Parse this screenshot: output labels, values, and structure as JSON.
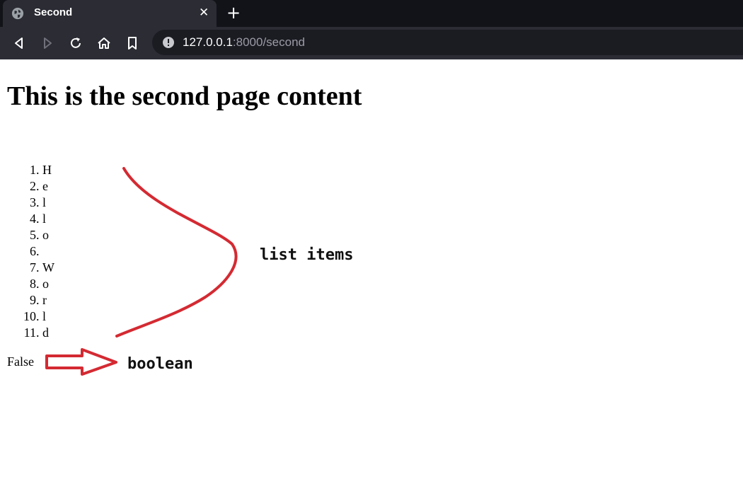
{
  "browser": {
    "tab_title": "Second",
    "tab_close_glyph": "✕",
    "new_tab_glyph": "+",
    "url_host": "127.0.0.1",
    "url_rest": ":8000/second",
    "icons": [
      "globe-icon",
      "back-icon",
      "forward-icon",
      "reload-icon",
      "home-icon",
      "bookmark-icon",
      "info-icon"
    ]
  },
  "page": {
    "title": "This is the second page content",
    "list_items": [
      "H",
      "e",
      "l",
      "l",
      "o",
      "",
      "W",
      "o",
      "r",
      "l",
      "d"
    ],
    "boolean_value": "False"
  },
  "annotations": {
    "list_label": "list items",
    "boolean_label": "boolean",
    "color": "#d42a32"
  }
}
